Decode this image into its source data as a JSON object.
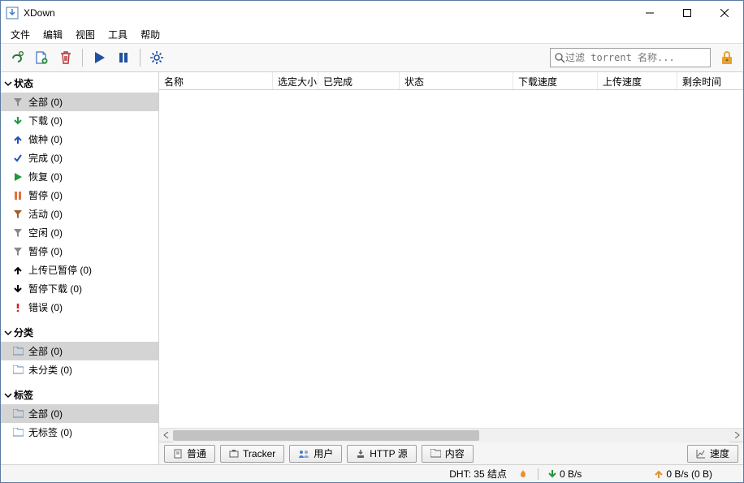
{
  "window": {
    "title": "XDown"
  },
  "menu": {
    "file": "文件",
    "edit": "编辑",
    "view": "视图",
    "tools": "工具",
    "help": "帮助"
  },
  "search": {
    "placeholder": "过滤 torrent 名称..."
  },
  "sidebar": {
    "status": {
      "header": "状态",
      "items": [
        {
          "label": "全部 (0)"
        },
        {
          "label": "下载 (0)"
        },
        {
          "label": "做种 (0)"
        },
        {
          "label": "完成 (0)"
        },
        {
          "label": "恢复 (0)"
        },
        {
          "label": "暂停 (0)"
        },
        {
          "label": "活动 (0)"
        },
        {
          "label": "空闲 (0)"
        },
        {
          "label": "暂停 (0)"
        },
        {
          "label": "上传已暂停 (0)"
        },
        {
          "label": "暂停下载 (0)"
        },
        {
          "label": "错误 (0)"
        }
      ]
    },
    "categories": {
      "header": "分类",
      "items": [
        {
          "label": "全部 (0)"
        },
        {
          "label": "未分类 (0)"
        }
      ]
    },
    "tags": {
      "header": "标签",
      "items": [
        {
          "label": "全部 (0)"
        },
        {
          "label": "无标签 (0)"
        }
      ]
    }
  },
  "columns": {
    "name": "名称",
    "selsize": "选定大小",
    "done": "已完成",
    "status": "状态",
    "dlspeed": "下载速度",
    "upspeed": "上传速度",
    "remaining": "剩余时间"
  },
  "tabs": {
    "general": "普通",
    "tracker": "Tracker",
    "user": "用户",
    "http": "HTTP 源",
    "content": "内容",
    "speed": "速度"
  },
  "status": {
    "dht": "DHT: 35 结点",
    "down": "0 B/s",
    "up": "0 B/s (0 B)"
  }
}
